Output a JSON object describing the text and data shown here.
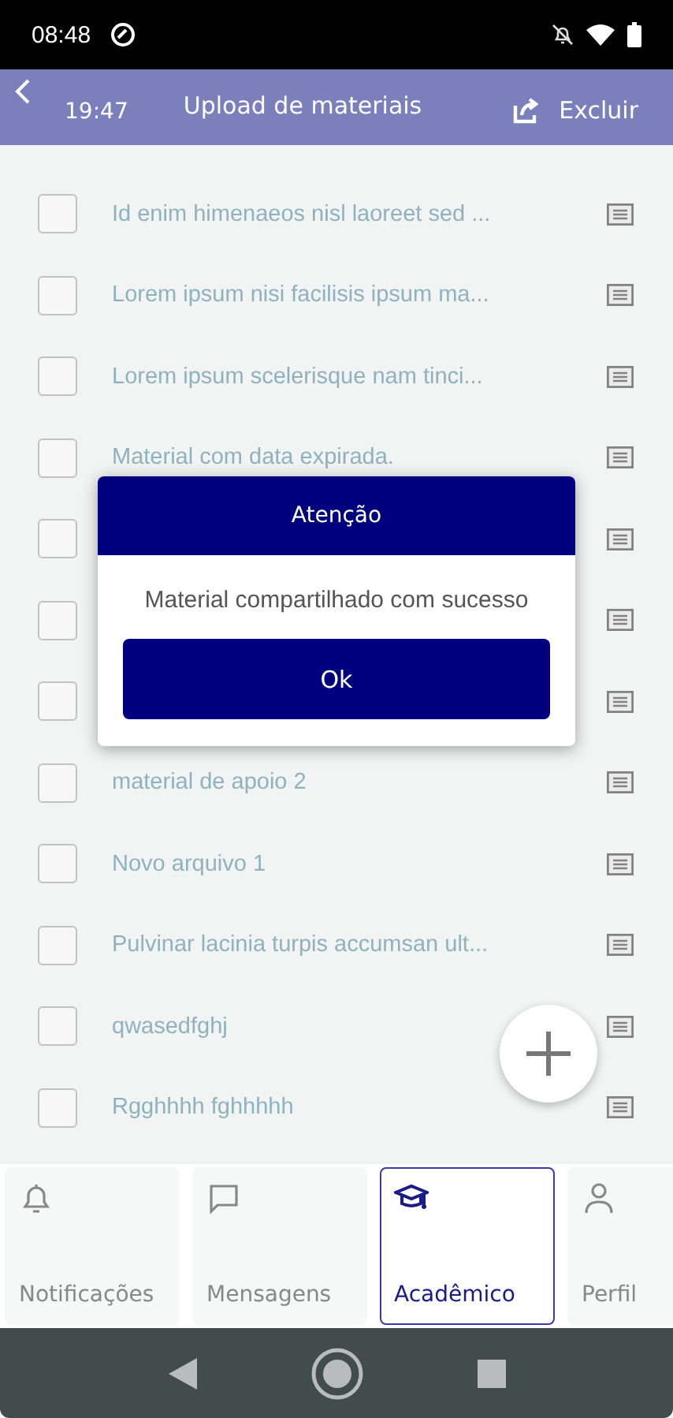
{
  "status_bar": {
    "time": "08:48"
  },
  "header": {
    "time": "19:47",
    "title": "Upload de materiais",
    "action": "Excluir"
  },
  "materials": [
    {
      "title": "Id enim himenaeos nisl laoreet sed ...",
      "checked": false
    },
    {
      "title": "Lorem ipsum nisi facilisis ipsum ma...",
      "checked": false
    },
    {
      "title": "Lorem ipsum scelerisque nam tinci...",
      "checked": false
    },
    {
      "title": "Material com data expirada.",
      "checked": false
    },
    {
      "checked": false
    },
    {
      "checked": false
    },
    {
      "checked": false
    },
    {
      "title": "material de apoio 2",
      "checked": false
    },
    {
      "title": "Novo arquivo 1",
      "checked": false
    },
    {
      "title": "Pulvinar lacinia turpis accumsan ult...",
      "checked": false
    },
    {
      "title": "qwasedfghj",
      "checked": false
    },
    {
      "title": "Rgghhhh fghhhhh",
      "checked": false
    }
  ],
  "dialog": {
    "title": "Atenção",
    "message": "Material compartilhado com sucesso",
    "button": "Ok"
  },
  "tabs": [
    {
      "kind": "bell",
      "label": "Notificações",
      "selected": false
    },
    {
      "kind": "chat",
      "label": "Mensagens",
      "selected": false
    },
    {
      "kind": "cap",
      "label": "Acadêmico",
      "selected": true
    },
    {
      "kind": "person",
      "label": "Perfil",
      "selected": false
    }
  ]
}
